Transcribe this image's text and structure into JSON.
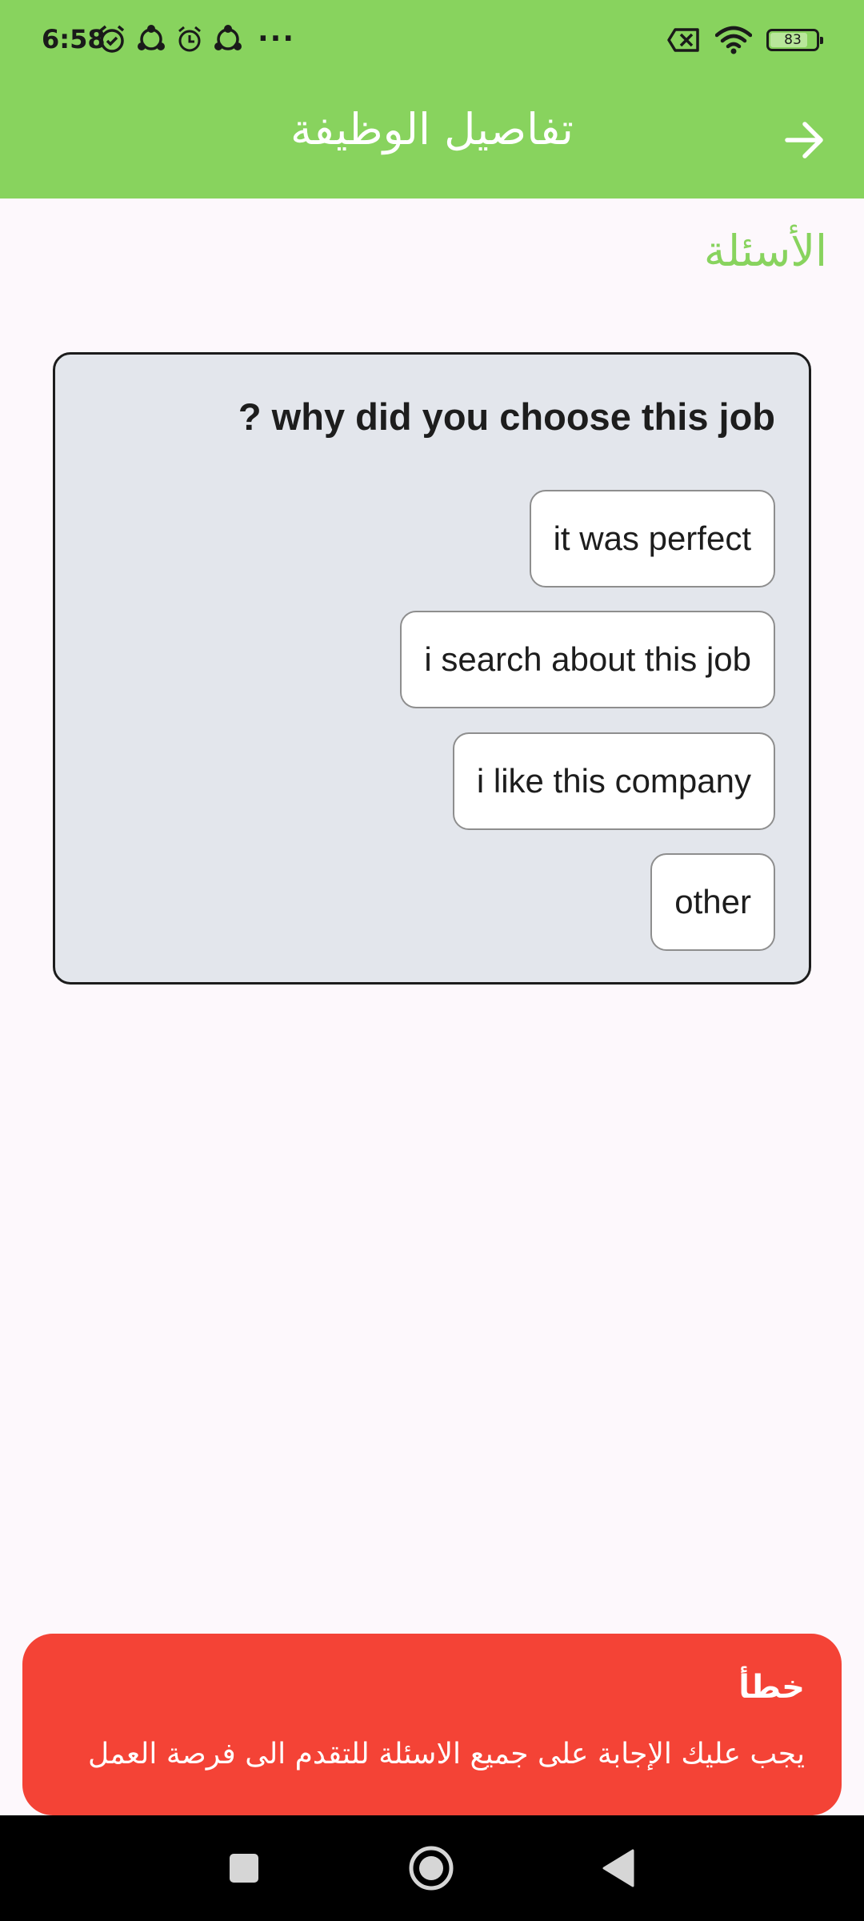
{
  "status_bar": {
    "time": "6:58",
    "battery": "83",
    "battery_level": 0.83
  },
  "app_bar": {
    "title": "تفاصيل الوظيفة"
  },
  "section": {
    "title": "الأسئلة"
  },
  "question": {
    "text": "? why did you choose this job",
    "options": [
      "it was perfect",
      "i search about this job",
      "i like this company",
      "other"
    ]
  },
  "error_toast": {
    "title": "خطأ",
    "message": "يجب عليك الإجابة على جميع الاسئلة للتقدم الى فرصة العمل"
  },
  "colors": {
    "app_bar": "#88d35e",
    "error": "#f44336",
    "card": "#e3e6ec",
    "background": "#fdf8fc"
  },
  "icons": {
    "back": "arrow-right-icon",
    "nav": [
      "recents-square-icon",
      "home-circle-icon",
      "back-triangle-icon"
    ]
  }
}
